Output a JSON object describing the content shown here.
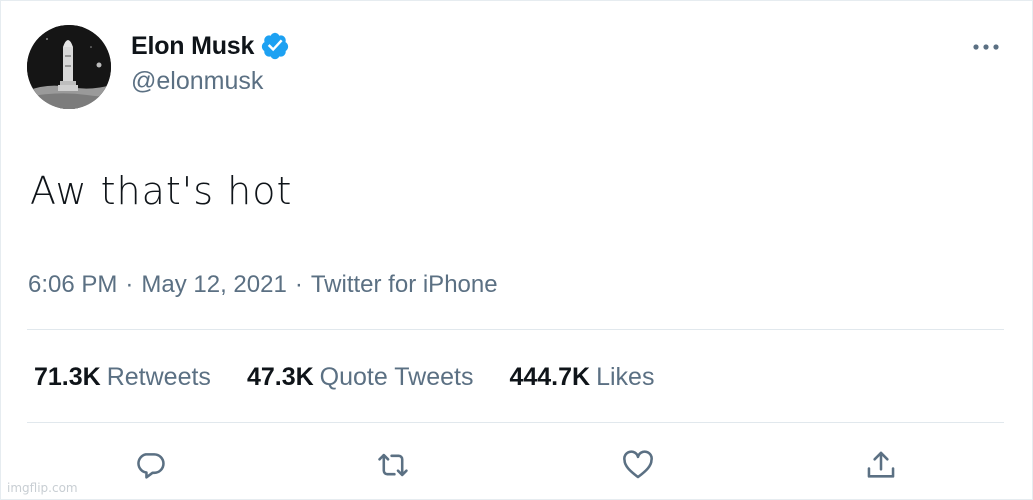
{
  "tweet": {
    "author": {
      "display_name": "Elon Musk",
      "handle": "@elonmusk",
      "verified": true,
      "avatar_icon": "starship-moon-avatar"
    },
    "text": "Aw that's hot",
    "meta": {
      "time": "6:06 PM",
      "separator1": "·",
      "date": "May 12, 2021",
      "separator2": "·",
      "source": "Twitter for iPhone"
    },
    "stats": {
      "retweets": {
        "count": "71.3K",
        "label": "Retweets"
      },
      "quote_tweets": {
        "count": "47.3K",
        "label": "Quote Tweets"
      },
      "likes": {
        "count": "444.7K",
        "label": "Likes"
      }
    },
    "actions": [
      {
        "name": "reply",
        "icon": "reply-icon"
      },
      {
        "name": "retweet",
        "icon": "retweet-icon"
      },
      {
        "name": "like",
        "icon": "heart-icon"
      },
      {
        "name": "share",
        "icon": "share-icon"
      }
    ],
    "more_icon": "more-dots-icon"
  },
  "watermark": "imgflip.com",
  "colors": {
    "text_primary": "#0f1419",
    "text_secondary": "#5b7083",
    "verified_blue": "#1da1f2",
    "divider": "#e1e8ed"
  }
}
